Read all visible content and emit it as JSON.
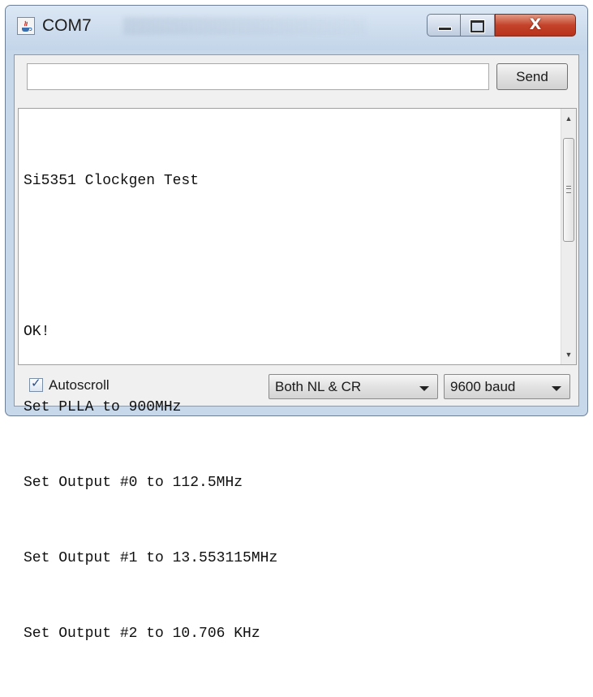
{
  "window": {
    "title": "COM7",
    "icon": "java-cup-icon",
    "controls": {
      "minimize_icon": "minimize-icon",
      "maximize_icon": "maximize-icon",
      "close_label": "X"
    },
    "close_color": "#c4432a"
  },
  "input": {
    "value": "",
    "placeholder": ""
  },
  "send_button": {
    "label": "Send"
  },
  "output": {
    "lines": [
      "Si5351 Clockgen Test",
      "",
      "OK!",
      "Set PLLA to 900MHz",
      "Set Output #0 to 112.5MHz",
      "Set Output #1 to 13.553115MHz",
      "Set Output #2 to 10.706 KHz"
    ]
  },
  "bottom": {
    "autoscroll_label": "Autoscroll",
    "autoscroll_checked": true,
    "line_ending": "Both NL & CR",
    "baud": "9600 baud"
  }
}
